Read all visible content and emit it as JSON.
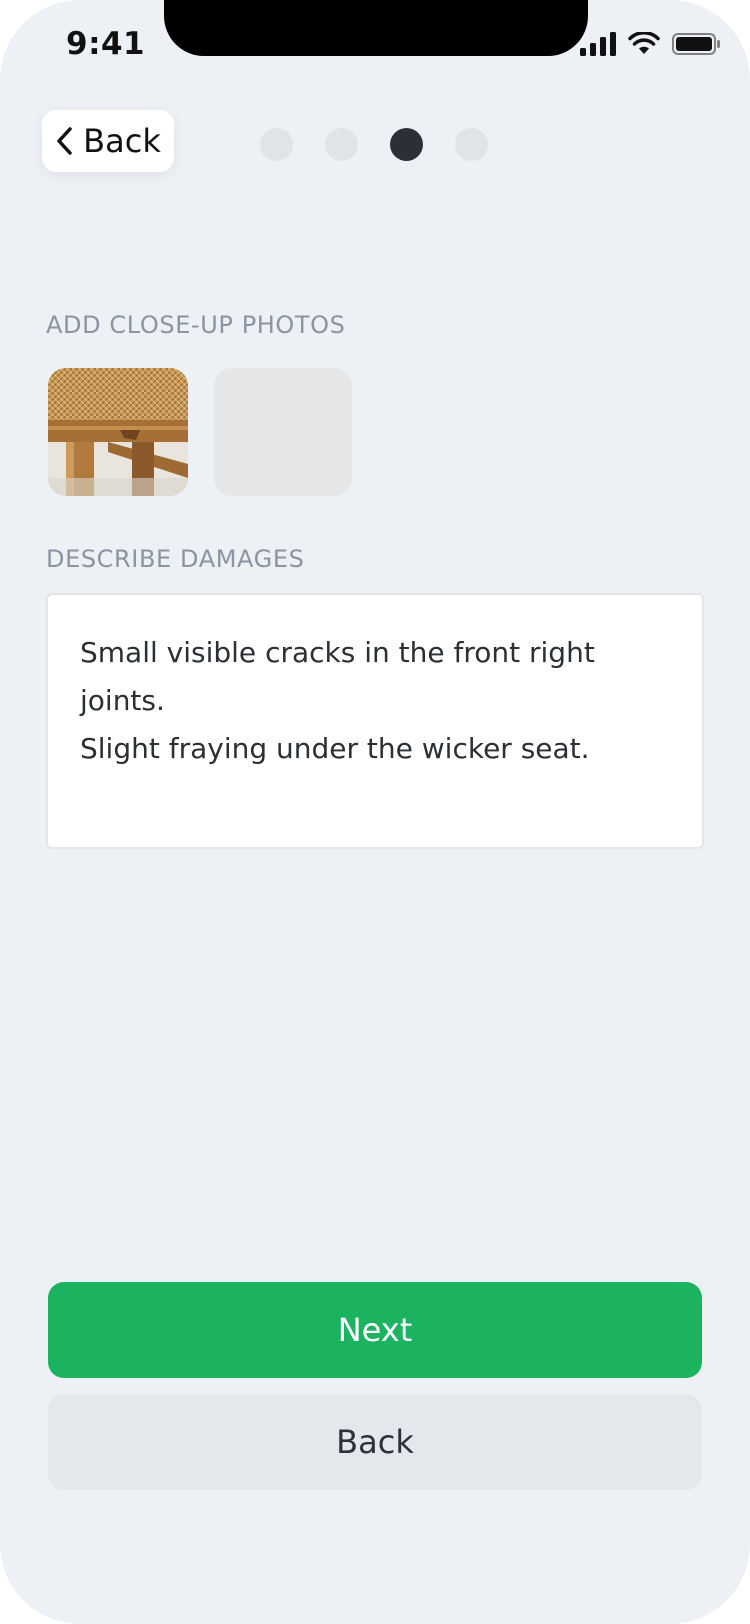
{
  "status_bar": {
    "time": "9:41",
    "icons": [
      "signal-icon",
      "wifi-icon",
      "battery-icon"
    ]
  },
  "header": {
    "back_label": "Back",
    "back_icon": "chevron-left-icon",
    "steps": {
      "total": 4,
      "current": 3
    }
  },
  "photos": {
    "label": "ADD CLOSE-UP PHOTOS",
    "items": [
      {
        "type": "photo",
        "subject": "wooden chair leg with wicker seat"
      },
      {
        "type": "empty-slot"
      }
    ]
  },
  "damages": {
    "label": "DESCRIBE DAMAGES",
    "value": "Small visible cracks in the front right joints.\nSlight fraying under the wicker seat."
  },
  "actions": {
    "next_label": "Next",
    "back_label": "Back"
  },
  "colors": {
    "background": "#edf0f4",
    "primary": "#1cb360",
    "active_step": "#2b2f36",
    "inactive_step": "#e0e3e8",
    "secondary_button": "#e4e7eb"
  }
}
